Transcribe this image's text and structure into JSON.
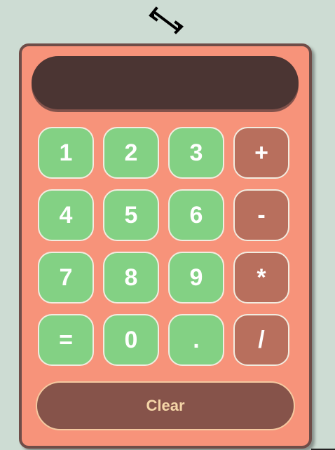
{
  "header": {
    "icon": "code-arrows-icon"
  },
  "display": {
    "value": ""
  },
  "keys": [
    {
      "label": "1",
      "kind": "num"
    },
    {
      "label": "2",
      "kind": "num"
    },
    {
      "label": "3",
      "kind": "num"
    },
    {
      "label": "+",
      "kind": "op"
    },
    {
      "label": "4",
      "kind": "num"
    },
    {
      "label": "5",
      "kind": "num"
    },
    {
      "label": "6",
      "kind": "num"
    },
    {
      "label": "-",
      "kind": "op"
    },
    {
      "label": "7",
      "kind": "num"
    },
    {
      "label": "8",
      "kind": "num"
    },
    {
      "label": "9",
      "kind": "num"
    },
    {
      "label": "*",
      "kind": "op"
    },
    {
      "label": "=",
      "kind": "num"
    },
    {
      "label": "0",
      "kind": "num"
    },
    {
      "label": ".",
      "kind": "num"
    },
    {
      "label": "/",
      "kind": "op"
    }
  ],
  "clear_label": "Clear",
  "colors": {
    "background": "#cddcd3",
    "frame": "#f7937a",
    "frame_border": "#6e4d48",
    "display": "#4b3533",
    "number_key": "#83d184",
    "operator_key": "#b86f5d",
    "clear_button": "#86534a",
    "clear_text": "#f5d6a8"
  }
}
